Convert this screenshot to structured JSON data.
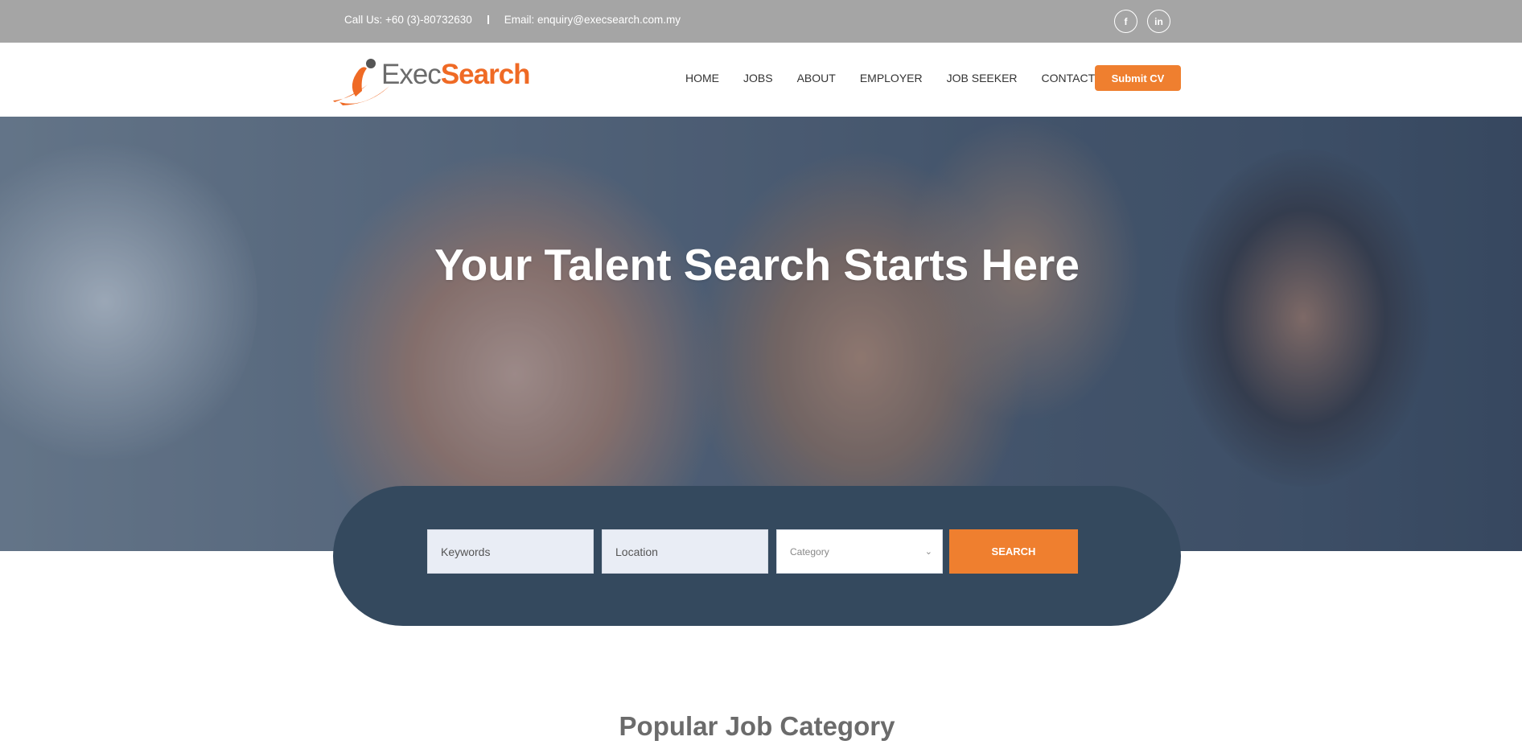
{
  "topbar": {
    "phone": "Call Us: +60 (3)-80732630",
    "email": "Email: enquiry@execsearch.com.my",
    "social": [
      "facebook-icon",
      "linkedin-icon"
    ]
  },
  "logo": {
    "part1": "Exec",
    "part2": "Search"
  },
  "nav": {
    "items": [
      "HOME",
      "JOBS",
      "ABOUT",
      "EMPLOYER",
      "JOB SEEKER",
      "CONTACT"
    ],
    "submit_label": "Submit CV"
  },
  "hero": {
    "title": "Your Talent Search Starts Here"
  },
  "search": {
    "keywords_placeholder": "Keywords",
    "location_placeholder": "Location",
    "category_label": "Category",
    "button_label": "SEARCH"
  },
  "section": {
    "title": "Popular Job Category"
  },
  "colors": {
    "accent": "#ef7f2f",
    "panel": "#34495e",
    "topbar": "#a5a5a5"
  }
}
